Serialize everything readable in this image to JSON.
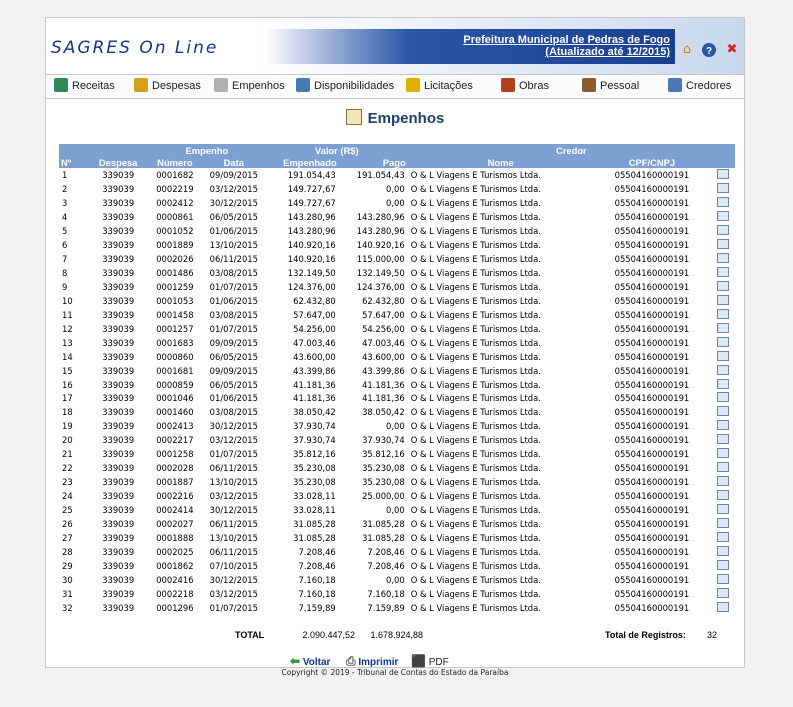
{
  "header": {
    "logo_text": "SAGRES On Line",
    "municipality": "Prefeitura Municipal de Pedras de Fogo",
    "updated": "(Atualizado até 12/2015)",
    "icons": [
      "home-icon",
      "help-icon",
      "close-icon"
    ]
  },
  "menu": [
    {
      "label": "Receitas",
      "icon": "spreadsheet-icon",
      "color": "#2e8b57"
    },
    {
      "label": "Despesas",
      "icon": "document-icon",
      "color": "#d4a017"
    },
    {
      "label": "Empenhos",
      "icon": "pencil-document-icon",
      "color": "#b0b0b0"
    },
    {
      "label": "Disponibilidades",
      "icon": "ledger-icon",
      "color": "#4a78b4"
    },
    {
      "label": "Licitações",
      "icon": "notepad-icon",
      "color": "#e0b000"
    },
    {
      "label": "Obras",
      "icon": "worker-icon",
      "color": "#b04020"
    },
    {
      "label": "Pessoal",
      "icon": "people-icon",
      "color": "#8a5a30"
    },
    {
      "label": "Credores",
      "icon": "contact-icon",
      "color": "#4a78b4"
    }
  ],
  "page_title": "Empenhos",
  "table": {
    "group_headers": {
      "empenho": "Empenho",
      "valor": "Valor (R$)",
      "credor": "Credor"
    },
    "columns": [
      "Nº",
      "Despesa",
      "Número",
      "Data",
      "Empenhado",
      "Pago",
      "Nome",
      "CPF/CNPJ"
    ],
    "rows": [
      [
        "1",
        "339039",
        "0001682",
        "09/09/2015",
        "191.054,43",
        "191.054,43",
        "O & L Viagens E Turismos Ltda.",
        "05504160000191"
      ],
      [
        "2",
        "339039",
        "0002219",
        "03/12/2015",
        "149.727,67",
        "0,00",
        "O & L Viagens E Turismos Ltda.",
        "05504160000191"
      ],
      [
        "3",
        "339039",
        "0002412",
        "30/12/2015",
        "149.727,67",
        "0,00",
        "O & L Viagens E Turismos Ltda.",
        "05504160000191"
      ],
      [
        "4",
        "339039",
        "0000861",
        "06/05/2015",
        "143.280,96",
        "143.280,96",
        "O & L Viagens E Turismos Ltda.",
        "05504160000191"
      ],
      [
        "5",
        "339039",
        "0001052",
        "01/06/2015",
        "143.280,96",
        "143.280,96",
        "O & L Viagens E Turismos Ltda.",
        "05504160000191"
      ],
      [
        "6",
        "339039",
        "0001889",
        "13/10/2015",
        "140.920,16",
        "140.920,16",
        "O & L Viagens E Turismos Ltda.",
        "05504160000191"
      ],
      [
        "7",
        "339039",
        "0002026",
        "06/11/2015",
        "140.920,16",
        "115.000,00",
        "O & L Viagens E Turismos Ltda.",
        "05504160000191"
      ],
      [
        "8",
        "339039",
        "0001486",
        "03/08/2015",
        "132.149,50",
        "132.149,50",
        "O & L Viagens E Turismos Ltda.",
        "05504160000191"
      ],
      [
        "9",
        "339039",
        "0001259",
        "01/07/2015",
        "124.376,00",
        "124.376,00",
        "O & L Viagens E Turismos Ltda.",
        "05504160000191"
      ],
      [
        "10",
        "339039",
        "0001053",
        "01/06/2015",
        "62.432,80",
        "62.432,80",
        "O & L Viagens E Turismos Ltda.",
        "05504160000191"
      ],
      [
        "11",
        "339039",
        "0001458",
        "03/08/2015",
        "57.647,00",
        "57.647,00",
        "O & L Viagens E Turismos Ltda.",
        "05504160000191"
      ],
      [
        "12",
        "339039",
        "0001257",
        "01/07/2015",
        "54.256,00",
        "54.256,00",
        "O & L Viagens E Turismos Ltda.",
        "05504160000191"
      ],
      [
        "13",
        "339039",
        "0001683",
        "09/09/2015",
        "47.003,46",
        "47.003,46",
        "O & L Viagens E Turismos Ltda.",
        "05504160000191"
      ],
      [
        "14",
        "339039",
        "0000860",
        "06/05/2015",
        "43.600,00",
        "43.600,00",
        "O & L Viagens E Turismos Ltda.",
        "05504160000191"
      ],
      [
        "15",
        "339039",
        "0001681",
        "09/09/2015",
        "43.399,86",
        "43.399,86",
        "O & L Viagens E Turismos Ltda.",
        "05504160000191"
      ],
      [
        "16",
        "339039",
        "0000859",
        "06/05/2015",
        "41.181,36",
        "41.181,36",
        "O & L Viagens E Turismos Ltda.",
        "05504160000191"
      ],
      [
        "17",
        "339039",
        "0001046",
        "01/06/2015",
        "41.181,36",
        "41.181,36",
        "O & L Viagens E Turismos Ltda.",
        "05504160000191"
      ],
      [
        "18",
        "339039",
        "0001460",
        "03/08/2015",
        "38.050,42",
        "38.050,42",
        "O & L Viagens E Turismos Ltda.",
        "05504160000191"
      ],
      [
        "19",
        "339039",
        "0002413",
        "30/12/2015",
        "37.930,74",
        "0,00",
        "O & L Viagens E Turismos Ltda.",
        "05504160000191"
      ],
      [
        "20",
        "339039",
        "0002217",
        "03/12/2015",
        "37.930,74",
        "37.930,74",
        "O & L Viagens E Turismos Ltda.",
        "05504160000191"
      ],
      [
        "21",
        "339039",
        "0001258",
        "01/07/2015",
        "35.812,16",
        "35.812,16",
        "O & L Viagens E Turismos Ltda.",
        "05504160000191"
      ],
      [
        "22",
        "339039",
        "0002028",
        "06/11/2015",
        "35.230,08",
        "35.230,08",
        "O & L Viagens E Turismos Ltda.",
        "05504160000191"
      ],
      [
        "23",
        "339039",
        "0001887",
        "13/10/2015",
        "35.230,08",
        "35.230,08",
        "O & L Viagens E Turismos Ltda.",
        "05504160000191"
      ],
      [
        "24",
        "339039",
        "0002216",
        "03/12/2015",
        "33.028,11",
        "25.000,00",
        "O & L Viagens E Turismos Ltda.",
        "05504160000191"
      ],
      [
        "25",
        "339039",
        "0002414",
        "30/12/2015",
        "33.028,11",
        "0,00",
        "O & L Viagens E Turismos Ltda.",
        "05504160000191"
      ],
      [
        "26",
        "339039",
        "0002027",
        "06/11/2015",
        "31.085,28",
        "31.085,28",
        "O & L Viagens E Turismos Ltda.",
        "05504160000191"
      ],
      [
        "27",
        "339039",
        "0001888",
        "13/10/2015",
        "31.085,28",
        "31.085,28",
        "O & L Viagens E Turismos Ltda.",
        "05504160000191"
      ],
      [
        "28",
        "339039",
        "0002025",
        "06/11/2015",
        "7.208,46",
        "7.208,46",
        "O & L Viagens E Turismos Ltda.",
        "05504160000191"
      ],
      [
        "29",
        "339039",
        "0001862",
        "07/10/2015",
        "7.208,46",
        "7.208,46",
        "O & L Viagens E Turismos Ltda.",
        "05504160000191"
      ],
      [
        "30",
        "339039",
        "0002416",
        "30/12/2015",
        "7.160,18",
        "0,00",
        "O & L Viagens E Turismos Ltda.",
        "05504160000191"
      ],
      [
        "31",
        "339039",
        "0002218",
        "03/12/2015",
        "7.160,18",
        "7.160,18",
        "O & L Viagens E Turismos Ltda.",
        "05504160000191"
      ],
      [
        "32",
        "339039",
        "0001296",
        "01/07/2015",
        "7.159,89",
        "7.159,89",
        "O & L Viagens E Turismos Ltda.",
        "05504160000191"
      ]
    ]
  },
  "totals": {
    "label": "TOTAL",
    "empenhado": "2.090.447,52",
    "pago": "1.678.924,88",
    "registros_label": "Total de Registros:",
    "registros": "32"
  },
  "footer": {
    "voltar": "Voltar",
    "imprimir": "Imprimir",
    "pdf": "PDF",
    "copyright": "Copyright © 2019 - Tribunal de Contas do Estado da Paraíba"
  }
}
